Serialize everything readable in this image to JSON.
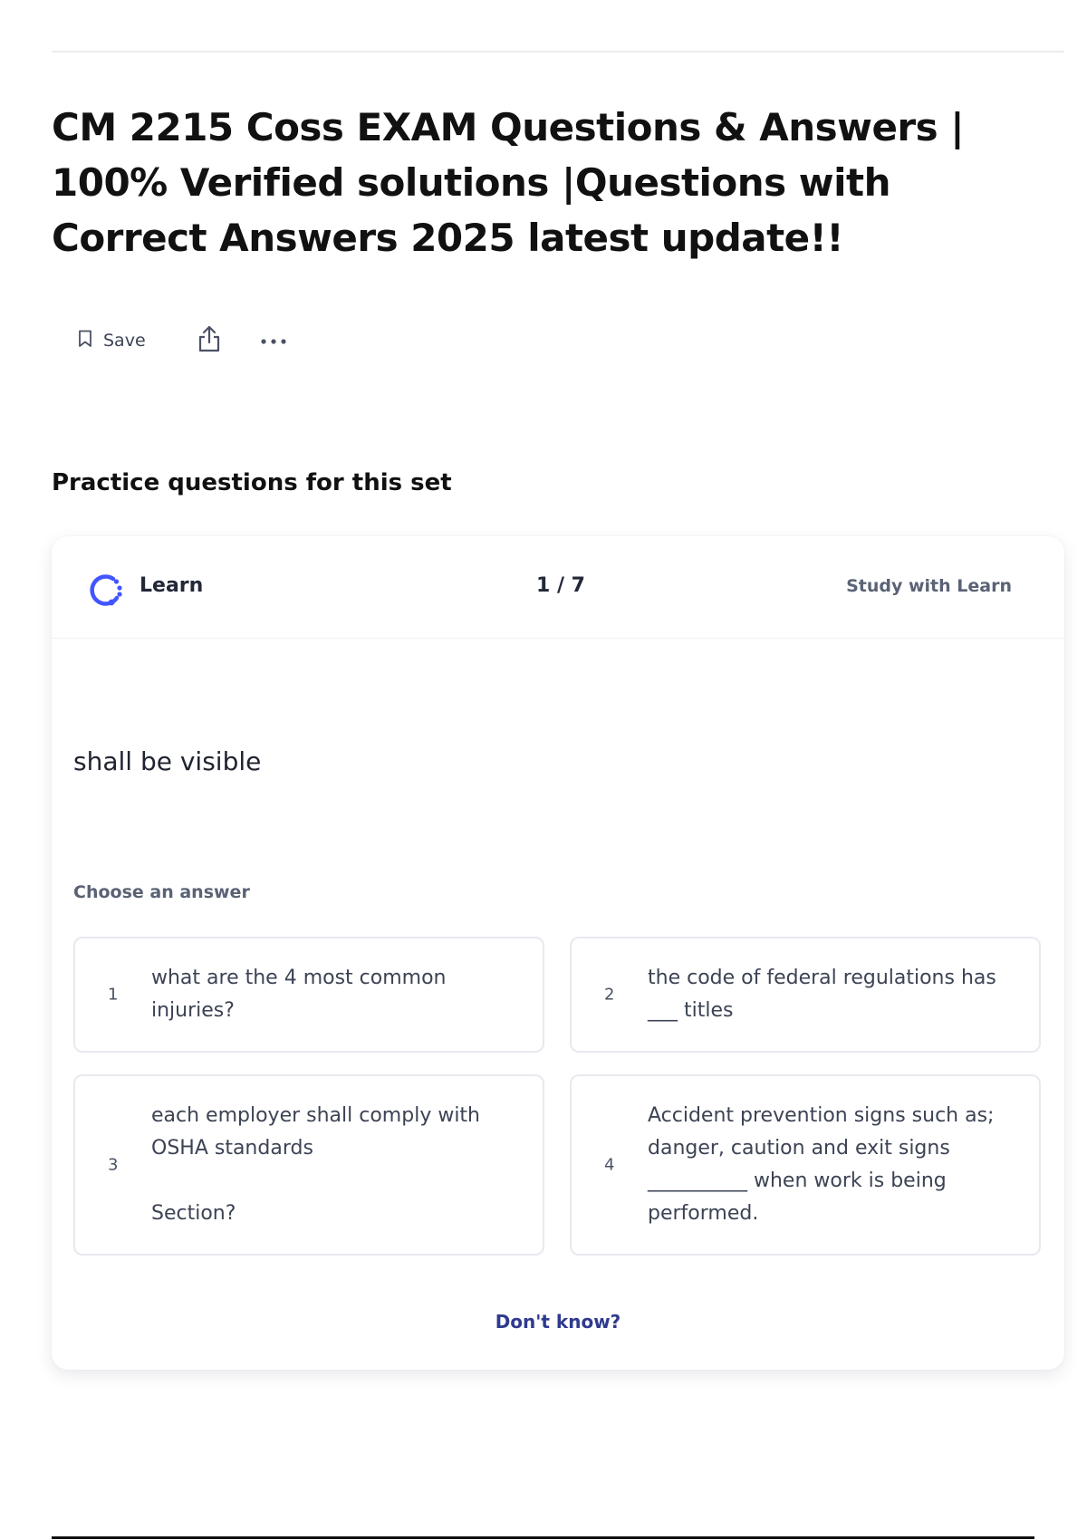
{
  "page": {
    "title": "CM 2215 Coss EXAM Questions & Answers | 100% Verified solutions |Questions with Correct Answers 2025 latest update!!"
  },
  "actions": {
    "save_label": "Save",
    "save_icon": "bookmark-icon",
    "share_icon": "share-icon",
    "more_icon": "more-horizontal-icon"
  },
  "practice": {
    "heading": "Practice questions for this set",
    "mode_label": "Learn",
    "mode_icon": "learn-icon",
    "progress": "1 / 7",
    "study_link": "Study with Learn",
    "prompt": "shall be visible",
    "choose_label": "Choose an answer",
    "answers": [
      {
        "number": "1",
        "text": "what are the 4 most common injuries?"
      },
      {
        "number": "2",
        "text": "the code of federal regulations has ___ titles"
      },
      {
        "number": "3",
        "text": "each employer shall comply with OSHA standards\n\nSection?"
      },
      {
        "number": "4",
        "text": "Accident prevention signs such as; danger, caution and exit signs __________ when work is being performed."
      }
    ],
    "dont_know": "Don't know?"
  },
  "colors": {
    "accent": "#4255ff",
    "link": "#2f3a8f",
    "muted_text": "#5a6275"
  }
}
